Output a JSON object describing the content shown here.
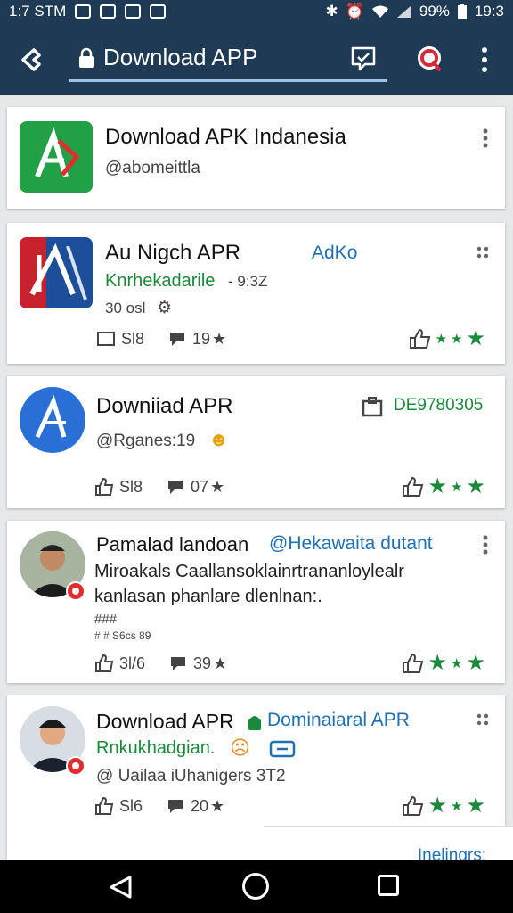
{
  "status_bar": {
    "time_left": "1:7 STM",
    "battery": "99%",
    "time_right": "19:3"
  },
  "app_bar": {
    "title": "Download APP"
  },
  "cards": [
    {
      "title": "Download APK Indanesia",
      "subtitle": "@abomeittla"
    },
    {
      "title": "Au Nigch APR",
      "badge": "AdKo",
      "green": "Knrhekadarile",
      "meta": "- 9:3Z",
      "info": "30 osl",
      "stat1": "Sl8",
      "stat2": "19"
    },
    {
      "title": "Downiiad APR",
      "code": "DE9780305",
      "subtitle": "@Rganes:19",
      "stat1": "Sl8",
      "stat2": "07"
    },
    {
      "title": "Pamalad landoan",
      "handle": "@Hekawaita dutant",
      "line1": "Miroakals Caallansoklainrtrananloylealr",
      "line2": "kanlasan phanlare dlenlnan:.",
      "line3": "###",
      "line4": "# # S6cs 89",
      "stat1": "3l/6",
      "stat2": "39"
    },
    {
      "title": "Download APR",
      "handle": "Dominaiaral APR",
      "green": "Rnkukhadgian.",
      "subtitle": "@ Uailaa iUhanigers 3T2",
      "stat1": "Sl6",
      "stat2": "20"
    }
  ],
  "peek_text": "Inelingrs:",
  "colors": {
    "appbar": "#1f3a55",
    "accent_green": "#1a8a3a",
    "accent_blue": "#1f6fb5"
  }
}
